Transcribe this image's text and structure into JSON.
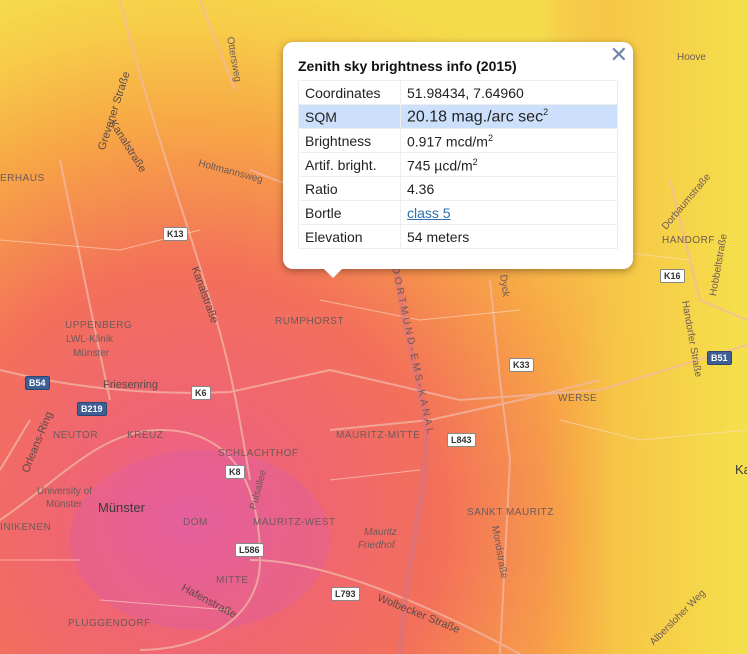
{
  "popup": {
    "title": "Zenith sky brightness info (2015)",
    "close_glyph": "✕",
    "rows": [
      {
        "key": "Coordinates",
        "value": "51.98434, 7.64960",
        "unit": "",
        "sup": ""
      },
      {
        "key": "SQM",
        "value": "20.18",
        "unit": " mag./arc sec",
        "sup": "2"
      },
      {
        "key": "Brightness",
        "value": "0.917",
        "unit": " mcd/m",
        "sup": "2"
      },
      {
        "key": "Artif. bright.",
        "value": "745",
        "unit": " µcd/m",
        "sup": "2"
      },
      {
        "key": "Ratio",
        "value": "4.36",
        "unit": "",
        "sup": ""
      },
      {
        "key": "Bortle",
        "value": "class 5",
        "unit": "",
        "sup": ""
      },
      {
        "key": "Elevation",
        "value": "54 meters",
        "unit": "",
        "sup": ""
      }
    ]
  },
  "map_labels": {
    "ottersweg": "Ottersweg",
    "kanalstrasse": "Kanalstraße",
    "kanalstrasse2": "Kanalstraße",
    "grevener": "Grevener Straße",
    "holtmannsweg": "Holtmannsweg",
    "uhlerhaus": "ERHAUS",
    "uppenberg": "UPPENBERG",
    "lwl": "LWL-Klinik",
    "lwl2": "Münster",
    "rumphorst": "RUMPHORST",
    "friesenring": "Friesenring",
    "orleans": "Orleans-Ring",
    "neutor": "NEUTOR",
    "kreuz": "KREUZ",
    "schlachthof": "SCHLACHTHOF",
    "mauritz_mitte": "MAURITZ-MITTE",
    "university": "University of",
    "university2": "Münster",
    "muenster": "Münster",
    "dom": "DOM",
    "mauritz_west": "MAURITZ-WEST",
    "klinik": "inikenen",
    "mauritz_friedhof": "Mauritz",
    "mauritz_friedhof2": "Friedhof",
    "mitte": "MITTE",
    "hafenstrasse": "Hafenstraße",
    "pluggendorf": "PLUGGENDORF",
    "wolbecker": "Wolbecker Straße",
    "dortmund_ems": "Dortmund-Ems-Kanal",
    "sankt_mauritz": "SANKT MAURITZ",
    "mondstrasse": "Mondstraße",
    "werse": "WERSE",
    "handorf": "HANDORF",
    "dorbaum": "Dorbaumstraße",
    "hobbelt": "Hobbeltstraße",
    "handorfer": "Handorfer Straße",
    "hoove": "Hoove",
    "dyck": "Dyck",
    "pulsallee": "Pulsallee",
    "ka": "Ka",
    "gasser": "Gasser Weg",
    "albersloher": "Albersloher Weg"
  },
  "road_shields": {
    "k13": "K13",
    "b54": "B54",
    "b219": "B219",
    "k6": "K6",
    "k8": "K8",
    "l586": "L586",
    "l793": "L793",
    "l843": "L843",
    "k33": "K33",
    "k16": "K16",
    "b51": "B51"
  },
  "colors": {
    "map_magenta": "#e8638f",
    "map_red": "#f26a5a",
    "map_orange": "#f7a148",
    "map_yellow": "#f6db4a",
    "popup_highlight": "#cde0fb",
    "link": "#2a6fb0"
  }
}
